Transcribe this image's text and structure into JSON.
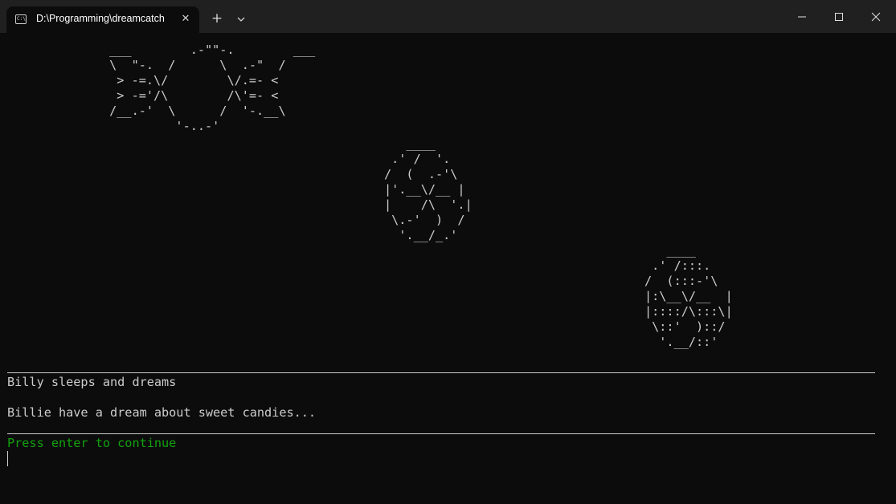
{
  "window": {
    "tab_title": "D:\\Programming\\dreamcatch",
    "tab_icon": "terminal-icon",
    "tab_close_glyph": "✕",
    "new_tab_glyph": "+",
    "icons": [
      "terminal-icon",
      "close-icon",
      "plus-icon",
      "chevron-down-icon",
      "minimize-icon",
      "maximize-icon",
      "window-close-icon"
    ]
  },
  "terminal": {
    "colors": {
      "background": "#0c0c0c",
      "text": "#cccccc",
      "prompt": "#13a10e"
    },
    "ascii_art": {
      "candy": " ___        .-\"\"-.        ___\n \\  \"-.  /      \\  .-\"  /\n  > -=.\\/        \\/.=- <\n  > -='/\\        /\\'=- <\n /__.-'  \\      /  '-.__\\\n          '-..-'",
      "ball": "   ____\n .' /  '.\n/  (  .-'\\\n|'.__\\/__ |\n|    /\\  '.|\n \\.-'  )  /\n  '.__/_.'",
      "ball_shaded": "   ____\n .' /:::.\n/  (:::-'\\\n|:\\__\\/__  |\n|::::/\\:::\\|\n \\::'  )::/\n  '.__/::'"
    },
    "separator": "________________________________________________________________________________________________________________________",
    "title_line": "Billy sleeps and dreams",
    "dream_line": "Billie have a dream about sweet candies...",
    "prompt": "Press enter to continue"
  }
}
